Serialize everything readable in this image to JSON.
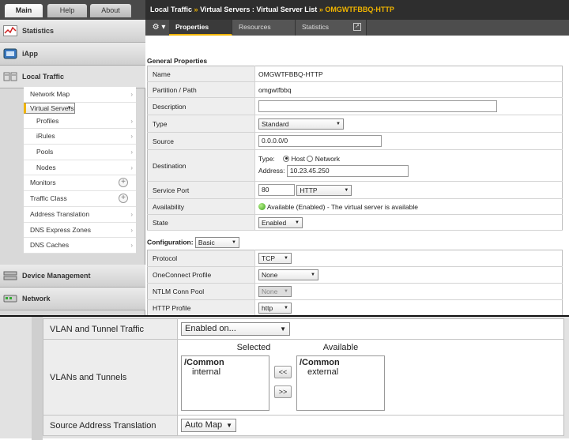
{
  "top_tabs": [
    "Main",
    "Help",
    "About"
  ],
  "header": {
    "crumb1": "Local Traffic",
    "sep": "»",
    "crumb2": "Virtual Servers : Virtual Server List",
    "current": "OMGWTFBBQ-HTTP"
  },
  "sub_tabs": [
    "Properties",
    "Resources",
    "Statistics"
  ],
  "sidebar": {
    "sections": [
      "Statistics",
      "iApp",
      "Local Traffic",
      "Device Management",
      "Network"
    ],
    "items": [
      {
        "label": "Network Map",
        "kind": "item"
      },
      {
        "label": "Virtual Servers",
        "kind": "selected"
      },
      {
        "label": "Profiles",
        "kind": "sub"
      },
      {
        "label": "iRules",
        "kind": "sub"
      },
      {
        "label": "Pools",
        "kind": "sub"
      },
      {
        "label": "Nodes",
        "kind": "sub"
      },
      {
        "label": "Monitors",
        "kind": "plus"
      },
      {
        "label": "Traffic Class",
        "kind": "plus"
      },
      {
        "label": "Address Translation",
        "kind": "item"
      },
      {
        "label": "DNS Express Zones",
        "kind": "item"
      },
      {
        "label": "DNS Caches",
        "kind": "item"
      }
    ]
  },
  "general": {
    "title": "General Properties",
    "name_label": "Name",
    "name_value": "OMGWTFBBQ-HTTP",
    "partition_label": "Partition / Path",
    "partition_value": "omgwtfbbq",
    "description_label": "Description",
    "description_value": "",
    "type_label": "Type",
    "type_value": "Standard",
    "source_label": "Source",
    "source_value": "0.0.0.0/0",
    "destination_label": "Destination",
    "dest_type_label": "Type:",
    "dest_host_label": "Host",
    "dest_network_label": "Network",
    "dest_address_label": "Address:",
    "dest_address_value": "10.23.45.250",
    "port_label": "Service Port",
    "port_value": "80",
    "port_protocol": "HTTP",
    "availability_label": "Availability",
    "availability_value": "Available (Enabled) - The virtual server is available",
    "state_label": "State",
    "state_value": "Enabled"
  },
  "configuration": {
    "title": "Configuration:",
    "mode": "Basic",
    "protocol_label": "Protocol",
    "protocol_value": "TCP",
    "oneconnect_label": "OneConnect Profile",
    "oneconnect_value": "None",
    "ntlm_label": "NTLM Conn Pool",
    "ntlm_value": "None",
    "http_label": "HTTP Profile",
    "http_value": "http"
  },
  "lower": {
    "vlan_label": "VLAN and Tunnel Traffic",
    "vlan_value": "Enabled on...",
    "vlans_label": "VLANs and Tunnels",
    "selected_header": "Selected",
    "available_header": "Available",
    "selected_group": "/Common",
    "selected_item": "internal",
    "available_group": "/Common",
    "available_item": "external",
    "move_left": "<<",
    "move_right": ">>",
    "snat_label": "Source Address Translation",
    "snat_value": "Auto Map"
  },
  "colors": {
    "accent": "#f0b400",
    "header_bg": "#2e2e2e",
    "label_bg": "#eeeeee"
  }
}
